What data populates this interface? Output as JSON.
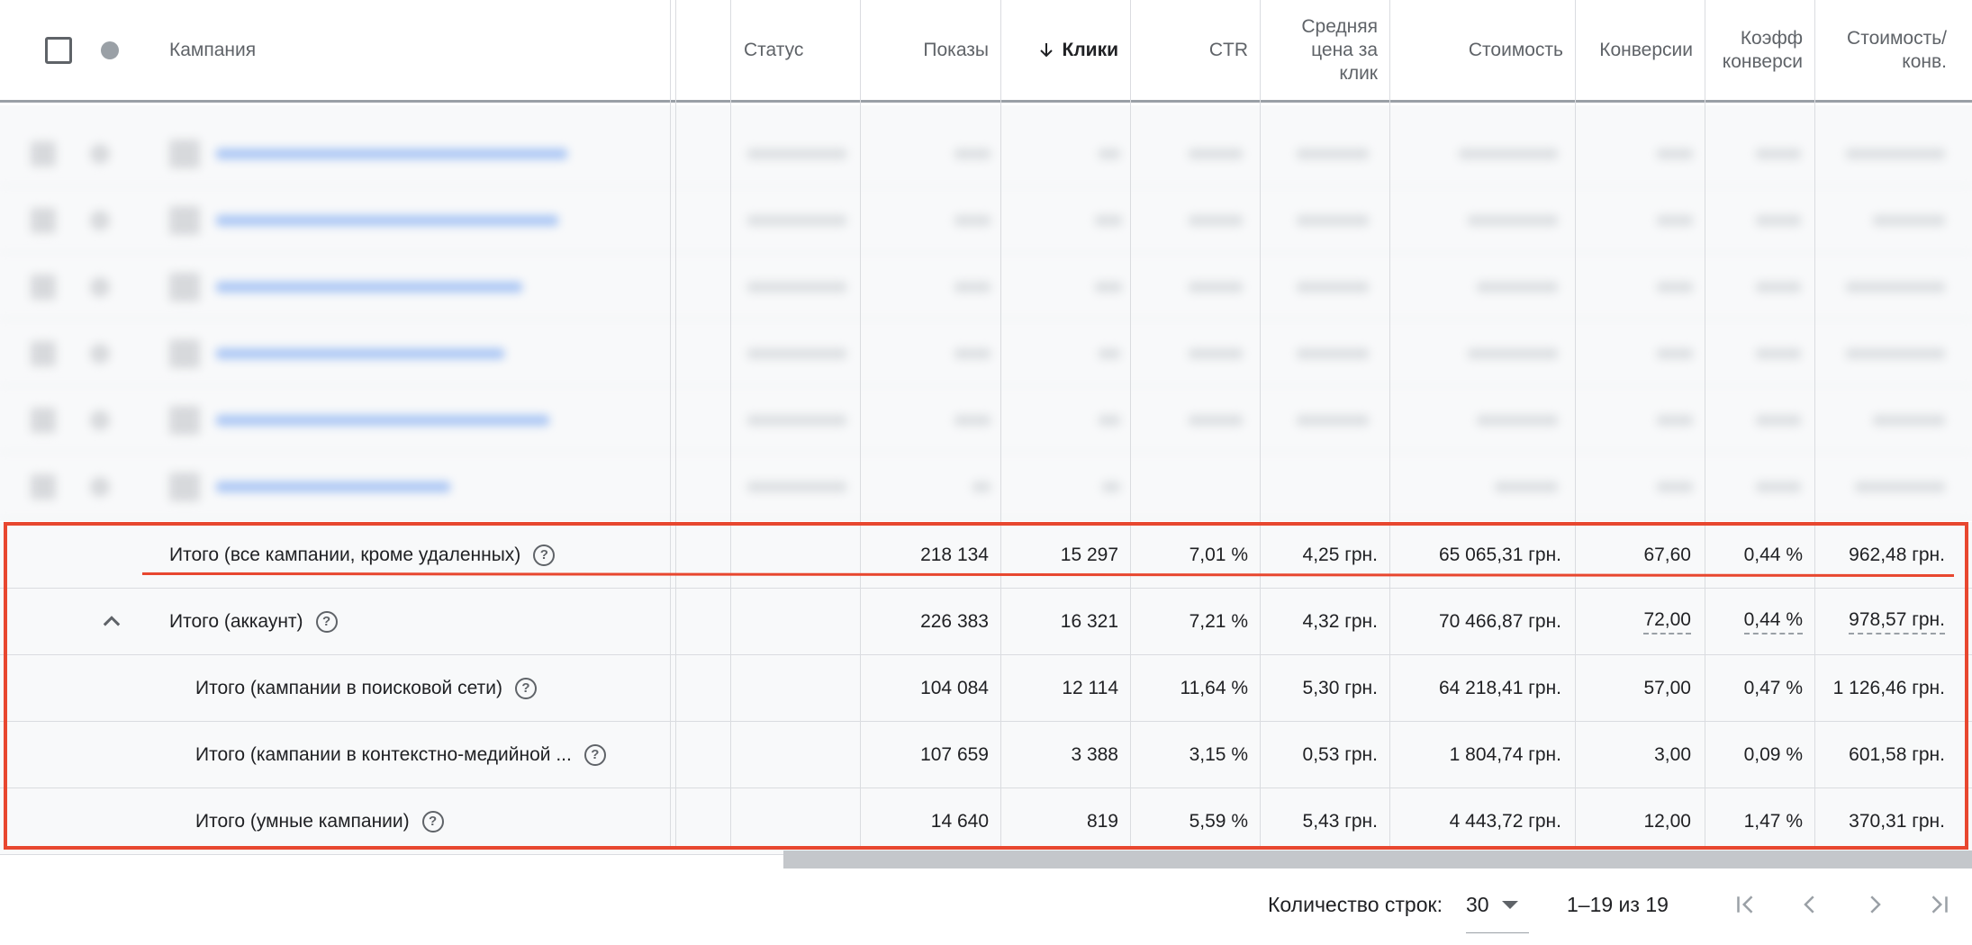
{
  "columns": {
    "campaign": "Кампания",
    "status": "Статус",
    "impressions": "Показы",
    "clicks": "Клики",
    "ctr": "CTR",
    "avg_cpc_l1": "Средняя",
    "avg_cpc_l2": "цена за",
    "avg_cpc_l3": "клик",
    "cost": "Стоимость",
    "conversions": "Конверсии",
    "conv_rate_l1": "Коэфф",
    "conv_rate_l2": "конверси",
    "cost_per_conv_l1": "Стоимость/",
    "cost_per_conv_l2": "конв."
  },
  "icons": {
    "sort": "arrow-down-icon",
    "help": "help-circle-icon",
    "collapse": "chevron-up-icon",
    "rows_select": "dropdown-caret-icon",
    "first": "first-page-icon",
    "prev": "chevron-left-icon",
    "next": "chevron-right-icon",
    "last": "last-page-icon"
  },
  "totals": [
    {
      "label": "Итого (все кампании, кроме удаленных)",
      "impressions": "218 134",
      "clicks": "15 297",
      "ctr": "7,01 %",
      "avg_cpc": "4,25 грн.",
      "cost": "65 065,31 грн.",
      "conversions": "67,60",
      "conv_rate": "0,44 %",
      "cost_per_conv": "962,48 грн."
    },
    {
      "label": "Итого (аккаунт)",
      "impressions": "226 383",
      "clicks": "16 321",
      "ctr": "7,21 %",
      "avg_cpc": "4,32 грн.",
      "cost": "70 466,87 грн.",
      "conversions": "72,00",
      "conv_rate": "0,44 %",
      "cost_per_conv": "978,57 грн."
    },
    {
      "label": "Итого (кампании в поисковой сети)",
      "impressions": "104 084",
      "clicks": "12 114",
      "ctr": "11,64 %",
      "avg_cpc": "5,30 грн.",
      "cost": "64 218,41 грн.",
      "conversions": "57,00",
      "conv_rate": "0,47 %",
      "cost_per_conv": "1 126,46 грн."
    },
    {
      "label": "Итого (кампании в контекстно-медийной ...",
      "impressions": "107 659",
      "clicks": "3 388",
      "ctr": "3,15 %",
      "avg_cpc": "0,53 грн.",
      "cost": "1 804,74 грн.",
      "conversions": "3,00",
      "conv_rate": "0,09 %",
      "cost_per_conv": "601,58 грн."
    },
    {
      "label": "Итого (умные кампании)",
      "impressions": "14 640",
      "clicks": "819",
      "ctr": "5,59 %",
      "avg_cpc": "5,43 грн.",
      "cost": "4 443,72 грн.",
      "conversions": "12,00",
      "conv_rate": "1,47 %",
      "cost_per_conv": "370,31 грн."
    }
  ],
  "footer": {
    "rows_label": "Количество строк:",
    "rows_value": "30",
    "range": "1–19 из 19"
  },
  "colors": {
    "highlight": "#e8472f",
    "link_blur": "#aac6f4",
    "header_border": "#9aa0a6"
  }
}
